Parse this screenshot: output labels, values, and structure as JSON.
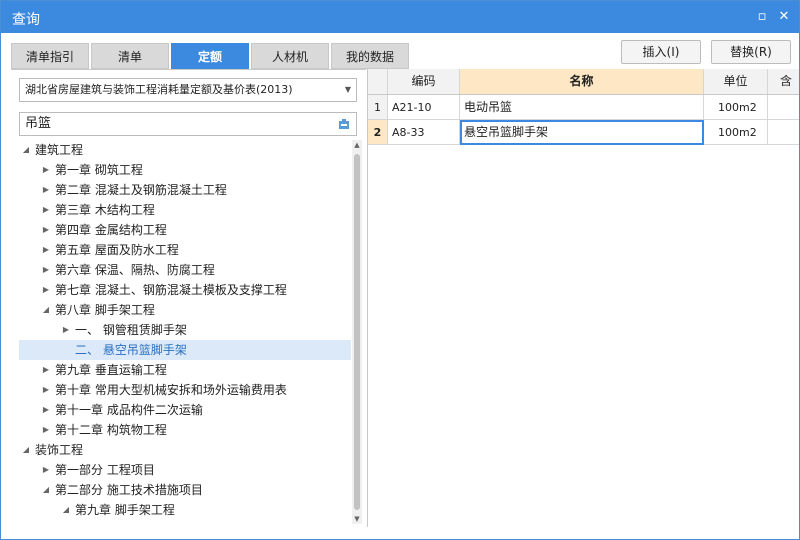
{
  "window": {
    "title": "查询"
  },
  "tabs": [
    {
      "label": "清单指引"
    },
    {
      "label": "清单"
    },
    {
      "label": "定额",
      "active": true
    },
    {
      "label": "人材机"
    },
    {
      "label": "我的数据"
    }
  ],
  "actions": {
    "insert_label": "插入(I)",
    "replace_label": "替换(R)"
  },
  "library_select": {
    "value": "湖北省房屋建筑与装饰工程消耗量定额及基价表(2013)"
  },
  "search": {
    "value": "吊篮"
  },
  "tree": [
    {
      "label": "建筑工程",
      "level": 0,
      "state": "expanded"
    },
    {
      "label": "第一章  砌筑工程",
      "level": 1,
      "state": "collapsed"
    },
    {
      "label": "第二章  混凝土及钢筋混凝土工程",
      "level": 1,
      "state": "collapsed"
    },
    {
      "label": "第三章  木结构工程",
      "level": 1,
      "state": "collapsed"
    },
    {
      "label": "第四章  金属结构工程",
      "level": 1,
      "state": "collapsed"
    },
    {
      "label": "第五章  屋面及防水工程",
      "level": 1,
      "state": "collapsed"
    },
    {
      "label": "第六章  保温、隔热、防腐工程",
      "level": 1,
      "state": "collapsed"
    },
    {
      "label": "第七章  混凝土、钢筋混凝土模板及支撑工程",
      "level": 1,
      "state": "collapsed"
    },
    {
      "label": "第八章  脚手架工程",
      "level": 1,
      "state": "expanded"
    },
    {
      "label": "一、  钢管租赁脚手架",
      "level": 2,
      "state": "collapsed"
    },
    {
      "label": "二、  悬空吊篮脚手架",
      "level": 2,
      "state": "leaf",
      "selected": true
    },
    {
      "label": "第九章  垂直运输工程",
      "level": 1,
      "state": "collapsed"
    },
    {
      "label": "第十章  常用大型机械安拆和场外运输费用表",
      "level": 1,
      "state": "collapsed"
    },
    {
      "label": "第十一章  成品构件二次运输",
      "level": 1,
      "state": "collapsed"
    },
    {
      "label": "第十二章  构筑物工程",
      "level": 1,
      "state": "collapsed"
    },
    {
      "label": "装饰工程",
      "level": 0,
      "state": "expanded"
    },
    {
      "label": "第一部分  工程项目",
      "level": 1,
      "state": "collapsed"
    },
    {
      "label": "第二部分  施工技术措施项目",
      "level": 1,
      "state": "expanded"
    },
    {
      "label": "第九章  脚手架工程",
      "level": 2,
      "state": "expanded"
    }
  ],
  "grid": {
    "columns": [
      "",
      "编码",
      "名称",
      "单位",
      "含"
    ],
    "rows": [
      {
        "num": "1",
        "code": "A21-10",
        "name": "电动吊篮",
        "unit": "100m2"
      },
      {
        "num": "2",
        "code": "A8-33",
        "name": "悬空吊篮脚手架",
        "unit": "100m2"
      }
    ]
  }
}
